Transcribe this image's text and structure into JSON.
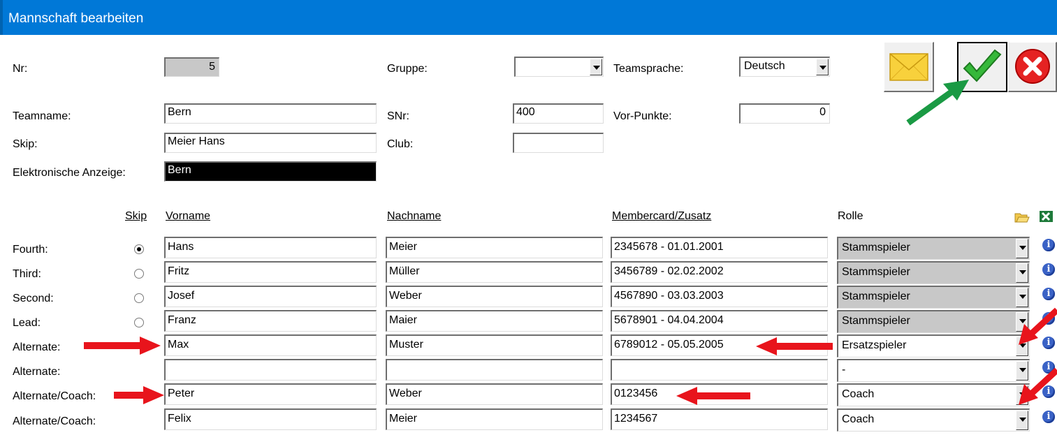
{
  "window": {
    "title": "Mannschaft bearbeiten"
  },
  "form": {
    "nr_label": "Nr:",
    "nr_value": "5",
    "gruppe_label": "Gruppe:",
    "gruppe_value": "",
    "teamsprache_label": "Teamsprache:",
    "teamsprache_value": "Deutsch",
    "teamname_label": "Teamname:",
    "teamname_value": "Bern",
    "snr_label": "SNr:",
    "snr_value": "400",
    "vorpunkte_label": "Vor-Punkte:",
    "vorpunkte_value": "0",
    "skip_label": "Skip:",
    "skip_value": "Meier Hans",
    "club_label": "Club:",
    "club_value": "",
    "anzeige_label": "Elektronische Anzeige:",
    "anzeige_value": "Bern"
  },
  "table": {
    "headers": {
      "skip": "Skip",
      "vorname": "Vorname",
      "nachname": "Nachname",
      "membercard": "Membercard/Zusatz",
      "rolle": "Rolle"
    },
    "rows": [
      {
        "position": "Fourth:",
        "skip": true,
        "vorname": "Hans",
        "nachname": "Meier",
        "membercard": "2345678 - 01.01.2001",
        "rolle": "Stammspieler"
      },
      {
        "position": "Third:",
        "skip": false,
        "vorname": "Fritz",
        "nachname": "Müller",
        "membercard": "3456789 - 02.02.2002",
        "rolle": "Stammspieler"
      },
      {
        "position": "Second:",
        "skip": false,
        "vorname": "Josef",
        "nachname": "Weber",
        "membercard": "4567890 - 03.03.2003",
        "rolle": "Stammspieler"
      },
      {
        "position": "Lead:",
        "skip": false,
        "vorname": "Franz",
        "nachname": "Maier",
        "membercard": "5678901 - 04.04.2004",
        "rolle": "Stammspieler"
      },
      {
        "position": "Alternate:",
        "vorname": "Max",
        "nachname": "Muster",
        "membercard": "6789012 - 05.05.2005",
        "rolle": "Ersatzspieler"
      },
      {
        "position": "Alternate:",
        "vorname": "",
        "nachname": "",
        "membercard": "",
        "rolle": "-"
      },
      {
        "position": "Alternate/Coach:",
        "vorname": "Peter",
        "nachname": "Weber",
        "membercard": "0123456",
        "rolle": "Coach"
      },
      {
        "position": "Alternate/Coach:",
        "vorname": "Felix",
        "nachname": "Meier",
        "membercard": "1234567",
        "rolle": "Coach"
      }
    ]
  },
  "icons": {
    "mail": "envelope-icon",
    "ok": "checkmark-icon",
    "cancel": "close-icon",
    "folder": "folder-icon",
    "excel": "excel-icon",
    "info": "info-icon"
  },
  "colors": {
    "titlebar": "#0078d7",
    "annotation_red": "#e8141c",
    "annotation_green": "#1a9a44"
  }
}
